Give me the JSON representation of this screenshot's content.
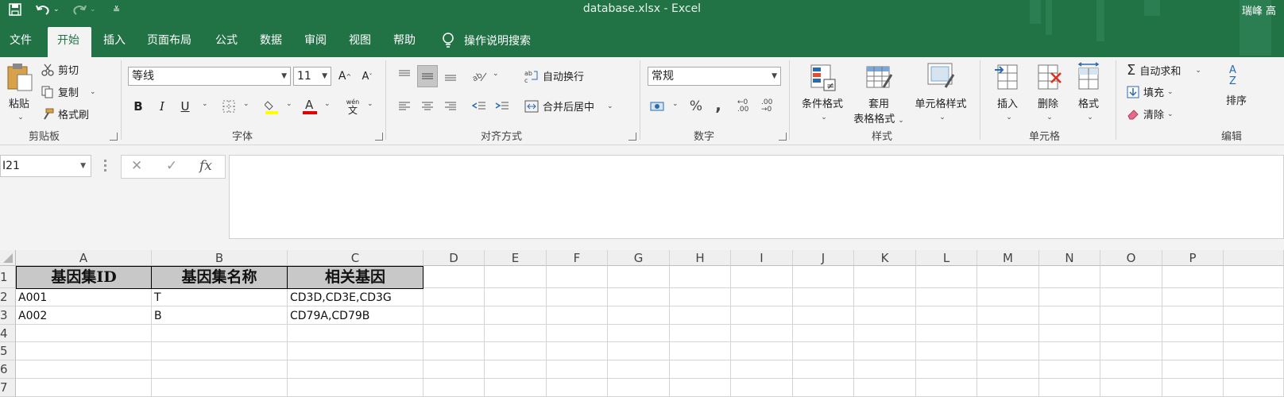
{
  "window": {
    "file_name": "database.xlsx",
    "separator": " - ",
    "app_name": "Excel",
    "user": "瑞峰 高"
  },
  "tabs": [
    "文件",
    "开始",
    "插入",
    "页面布局",
    "公式",
    "数据",
    "审阅",
    "视图",
    "帮助"
  ],
  "active_tab": "开始",
  "tell_me": "操作说明搜索",
  "clipboard": {
    "paste": "粘贴",
    "cut": "剪切",
    "copy": "复制",
    "format_painter": "格式刷",
    "label": "剪贴板"
  },
  "font": {
    "name": "等线",
    "size": "11",
    "bold": "B",
    "italic": "I",
    "underline": "U",
    "label": "字体",
    "phonetic": "wén"
  },
  "alignment": {
    "wrap": "自动换行",
    "merge": "合并后居中",
    "label": "对齐方式"
  },
  "number": {
    "format": "常规",
    "percent": "%",
    "comma": ",",
    "inc_decimal": "←0 .00",
    "dec_decimal": ".00 →0",
    "label": "数字"
  },
  "styles": {
    "conditional": "条件格式",
    "table_line1": "套用",
    "table_line2": "表格格式",
    "cell_styles": "单元格样式",
    "label": "样式"
  },
  "cells": {
    "insert": "插入",
    "delete": "删除",
    "format": "格式",
    "label": "单元格"
  },
  "editing": {
    "autosum": "自动求和",
    "fill": "填充",
    "clear": "清除",
    "sort": "排序",
    "label": "编辑"
  },
  "formula_bar": {
    "name_box": "I21",
    "cancel": "✕",
    "enter": "✓",
    "fx": "fx",
    "content": ""
  },
  "sheet": {
    "columns": [
      "A",
      "B",
      "C",
      "D",
      "E",
      "F",
      "G",
      "H",
      "I",
      "J",
      "K",
      "L",
      "M",
      "N",
      "O",
      "P"
    ],
    "rows": [
      "1",
      "2",
      "3",
      "4",
      "5",
      "6",
      "7"
    ],
    "header_row": [
      "基因集ID",
      "基因集名称",
      "相关基因"
    ],
    "data": [
      [
        "A001",
        "T",
        "CD3D,CD3E,CD3G"
      ],
      [
        "A002",
        "B",
        "CD79A,CD79B"
      ]
    ]
  },
  "colors": {
    "excel_green": "#217346",
    "header_fill": "#C8C8C8"
  }
}
